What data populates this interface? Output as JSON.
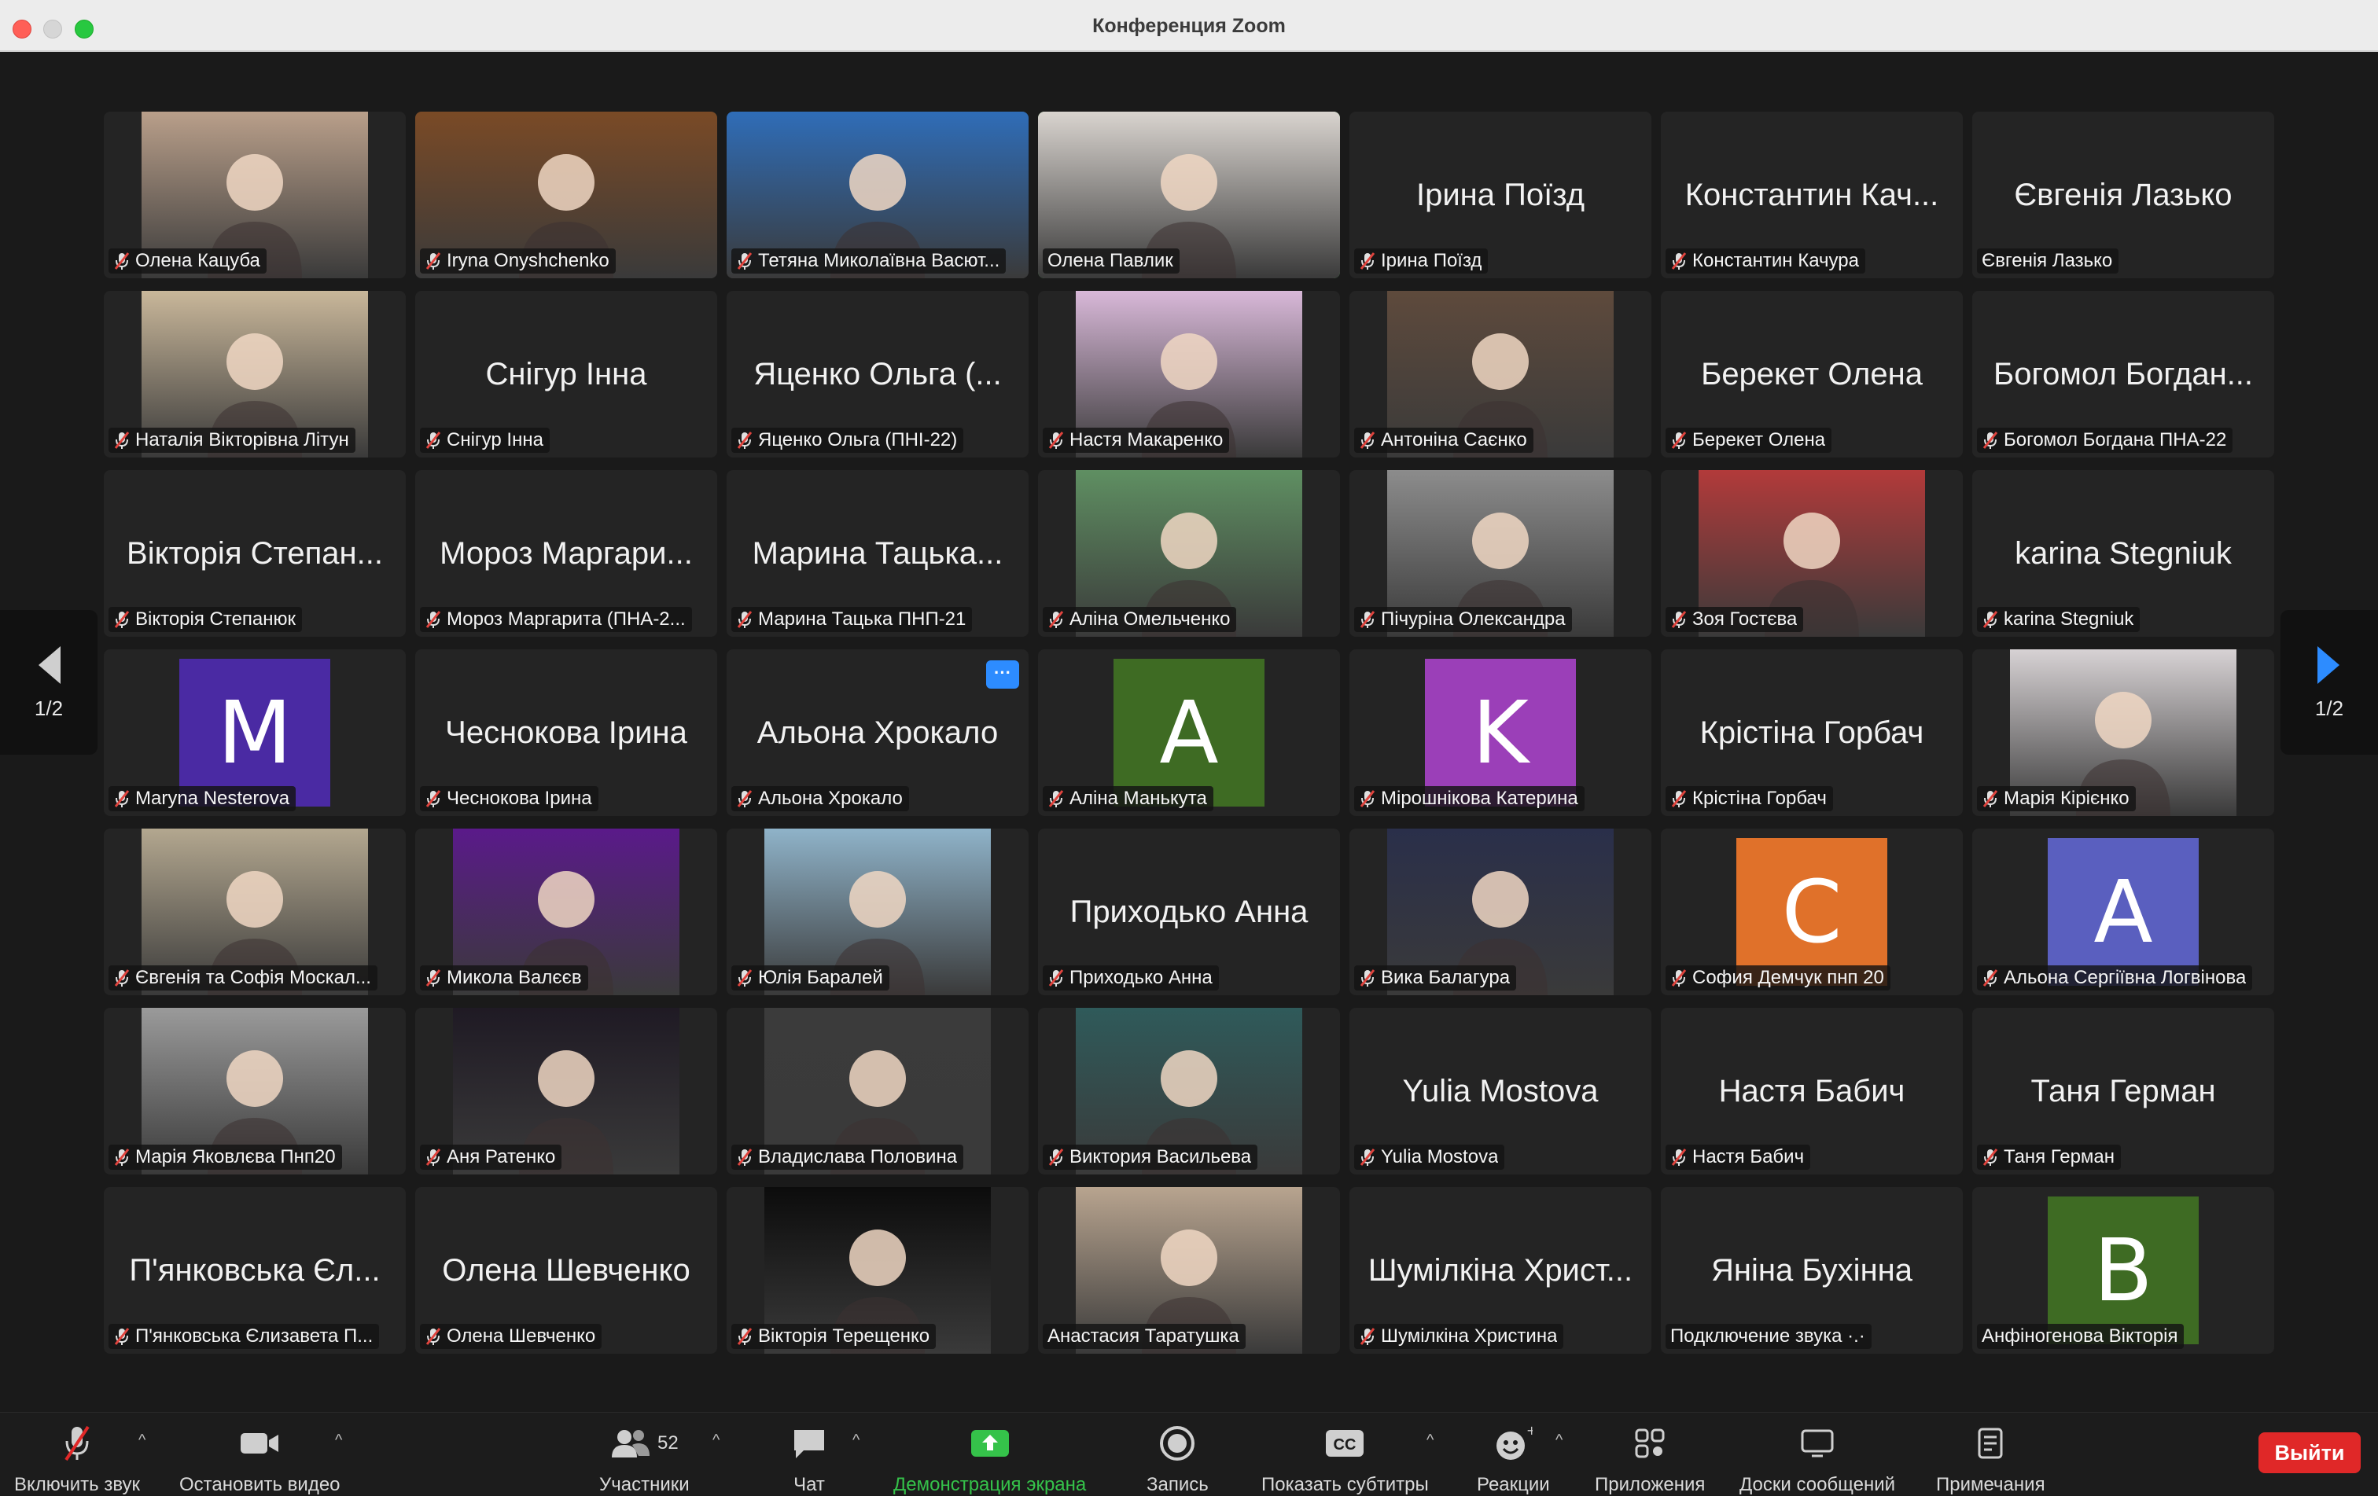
{
  "window": {
    "title": "Конференция Zoom"
  },
  "pagination": {
    "left": "1/2",
    "right": "1/2"
  },
  "tiles": [
    {
      "kind": "video",
      "label": "Олена Кацуба",
      "muted": true,
      "bg": "#b99f8a"
    },
    {
      "kind": "video",
      "label": "Iryna Onyshchenko",
      "muted": true,
      "bg": "#7a4a26"
    },
    {
      "kind": "video",
      "label": "Тетяна Миколаївна Васют...",
      "muted": true,
      "bg": "#2f6db8"
    },
    {
      "kind": "video",
      "label": "Олена Павлик",
      "muted": false,
      "bg": "#d9d4cf",
      "active": true
    },
    {
      "kind": "name",
      "name": "Ірина Поїзд",
      "label": "Ірина Поїзд",
      "muted": true
    },
    {
      "kind": "name",
      "name": "Константин Кач...",
      "label": "Константин Качура",
      "muted": true
    },
    {
      "kind": "name",
      "name": "Євгенія Лазько",
      "label": "Євгенія Лазько",
      "muted": false
    },
    {
      "kind": "video",
      "label": "Наталія Вікторівна Літун",
      "muted": true,
      "bg": "#c9b79a"
    },
    {
      "kind": "name",
      "name": "Снігур Інна",
      "label": "Снігур Інна",
      "muted": true
    },
    {
      "kind": "name",
      "name": "Яценко Ольга (...",
      "label": "Яценко Ольга (ПНІ-22)",
      "muted": true
    },
    {
      "kind": "video",
      "label": "Настя Макаренко",
      "muted": true,
      "bg": "#d8b8d8"
    },
    {
      "kind": "video",
      "label": "Антоніна Саєнко",
      "muted": true,
      "bg": "#5e4a3c"
    },
    {
      "kind": "name",
      "name": "Берекет Олена",
      "label": "Берекет Олена",
      "muted": true
    },
    {
      "kind": "name",
      "name": "Богомол Богдан...",
      "label": "Богомол Богдана ПНА-22",
      "muted": true
    },
    {
      "kind": "name",
      "name": "Вікторія Степан...",
      "label": "Вікторія Степанюк",
      "muted": true
    },
    {
      "kind": "name",
      "name": "Мороз Маргари...",
      "label": "Мороз Маргарита (ПНА-2...",
      "muted": true
    },
    {
      "kind": "name",
      "name": "Марина Тацька...",
      "label": "Марина Тацька ПНП-21",
      "muted": true
    },
    {
      "kind": "video",
      "label": "Аліна Омельченко",
      "muted": true,
      "bg": "#5f8f62"
    },
    {
      "kind": "video",
      "label": "Пічуріна Олександра",
      "muted": true,
      "bg": "#8c8c8c"
    },
    {
      "kind": "video",
      "label": "Зоя Гостєва",
      "muted": true,
      "bg": "#b23a3a"
    },
    {
      "kind": "name",
      "name": "karina Stegniuk",
      "label": "karina Stegniuk",
      "muted": true
    },
    {
      "kind": "avatar",
      "letter": "M",
      "color": "#4a2aa3",
      "label": "Maryna Nesterova",
      "muted": true
    },
    {
      "kind": "name",
      "name": "Чеснокова Ірина",
      "label": "Чеснокова Ірина",
      "muted": true
    },
    {
      "kind": "name",
      "name": "Альона Хрокало",
      "label": "Альона Хрокало",
      "muted": true,
      "more": "···"
    },
    {
      "kind": "avatar",
      "letter": "A",
      "color": "#3e6b23",
      "label": "Аліна Манькута",
      "muted": true
    },
    {
      "kind": "avatar",
      "letter": "K",
      "color": "#9b3fb8",
      "label": "Мірошнікова Катерина",
      "muted": true
    },
    {
      "kind": "name",
      "name": "Крістіна Горбач",
      "label": "Крістіна Горбач",
      "muted": true
    },
    {
      "kind": "video",
      "label": "Марія Кірієнко",
      "muted": true,
      "bg": "#d7d2d4"
    },
    {
      "kind": "video",
      "label": "Євгенія та Софія Москал...",
      "muted": true,
      "bg": "#b3a78f"
    },
    {
      "kind": "video",
      "label": "Микола Валєєв",
      "muted": true,
      "bg": "#5a1a8a"
    },
    {
      "kind": "video",
      "label": "Юлія Баралей",
      "muted": true,
      "bg": "#8fb3c9"
    },
    {
      "kind": "name",
      "name": "Приходько Анна",
      "label": "Приходько Анна",
      "muted": true
    },
    {
      "kind": "video",
      "label": "Вика Балагура",
      "muted": true,
      "bg": "#2a2f4a"
    },
    {
      "kind": "avatar",
      "letter": "C",
      "color": "#e0712a",
      "label": "София Демчук пнп 20",
      "muted": true
    },
    {
      "kind": "avatar",
      "letter": "A",
      "color": "#5a5fbf",
      "label": "Альона Сергіївна Логвінова",
      "muted": true
    },
    {
      "kind": "video",
      "label": "Марія Яковлєва Пнп20",
      "muted": true,
      "bg": "#9a9a9a"
    },
    {
      "kind": "video",
      "label": "Аня Ратенко",
      "muted": true,
      "bg": "#1f1a24"
    },
    {
      "kind": "video",
      "label": "Владислава Половина",
      "muted": true,
      "bg": "#3b3b3b"
    },
    {
      "kind": "video",
      "label": "Виктория Васильева",
      "muted": true,
      "bg": "#2f5a5a"
    },
    {
      "kind": "name",
      "name": "Yulia Mostova",
      "label": "Yulia Mostova",
      "muted": true
    },
    {
      "kind": "name",
      "name": "Настя Бабич",
      "label": "Настя Бабич",
      "muted": true
    },
    {
      "kind": "name",
      "name": "Таня Герман",
      "label": "Таня Герман",
      "muted": true
    },
    {
      "kind": "name",
      "name": "П'янковська Єл...",
      "label": "П'янковська Єлизавета П...",
      "muted": true
    },
    {
      "kind": "name",
      "name": "Олена Шевченко",
      "label": "Олена Шевченко",
      "muted": true
    },
    {
      "kind": "video",
      "label": "Вікторія Терещенко",
      "muted": true,
      "bg": "#0c0c0c"
    },
    {
      "kind": "video",
      "label": "Анастасия Таратушка",
      "muted": false,
      "bg": "#b8a48f"
    },
    {
      "kind": "name",
      "name": "Шумілкіна Христ...",
      "label": "Шумілкіна Христина",
      "muted": true
    },
    {
      "kind": "name",
      "name": "Яніна Бухінна",
      "label": "Подключение звука ·.·",
      "muted": false
    },
    {
      "kind": "avatar",
      "letter": "B",
      "color": "#3e6b23",
      "label": "Анфіногенова Вікторія",
      "muted": false
    }
  ],
  "toolbar": {
    "unmute": "Включить звук",
    "stop_video": "Остановить видео",
    "participants": "Участники",
    "participants_count": "52",
    "chat": "Чат",
    "share": "Демонстрация экрана",
    "record": "Запись",
    "captions": "Показать субтитры",
    "reactions": "Реакции",
    "apps": "Приложения",
    "whiteboards": "Доски сообщений",
    "notes": "Примечания",
    "leave": "Выйти"
  },
  "colors": {
    "active_speaker": "#4ec95a",
    "share_green": "#35c24a",
    "leave_red": "#e02828",
    "more_blue": "#2d8cff"
  }
}
